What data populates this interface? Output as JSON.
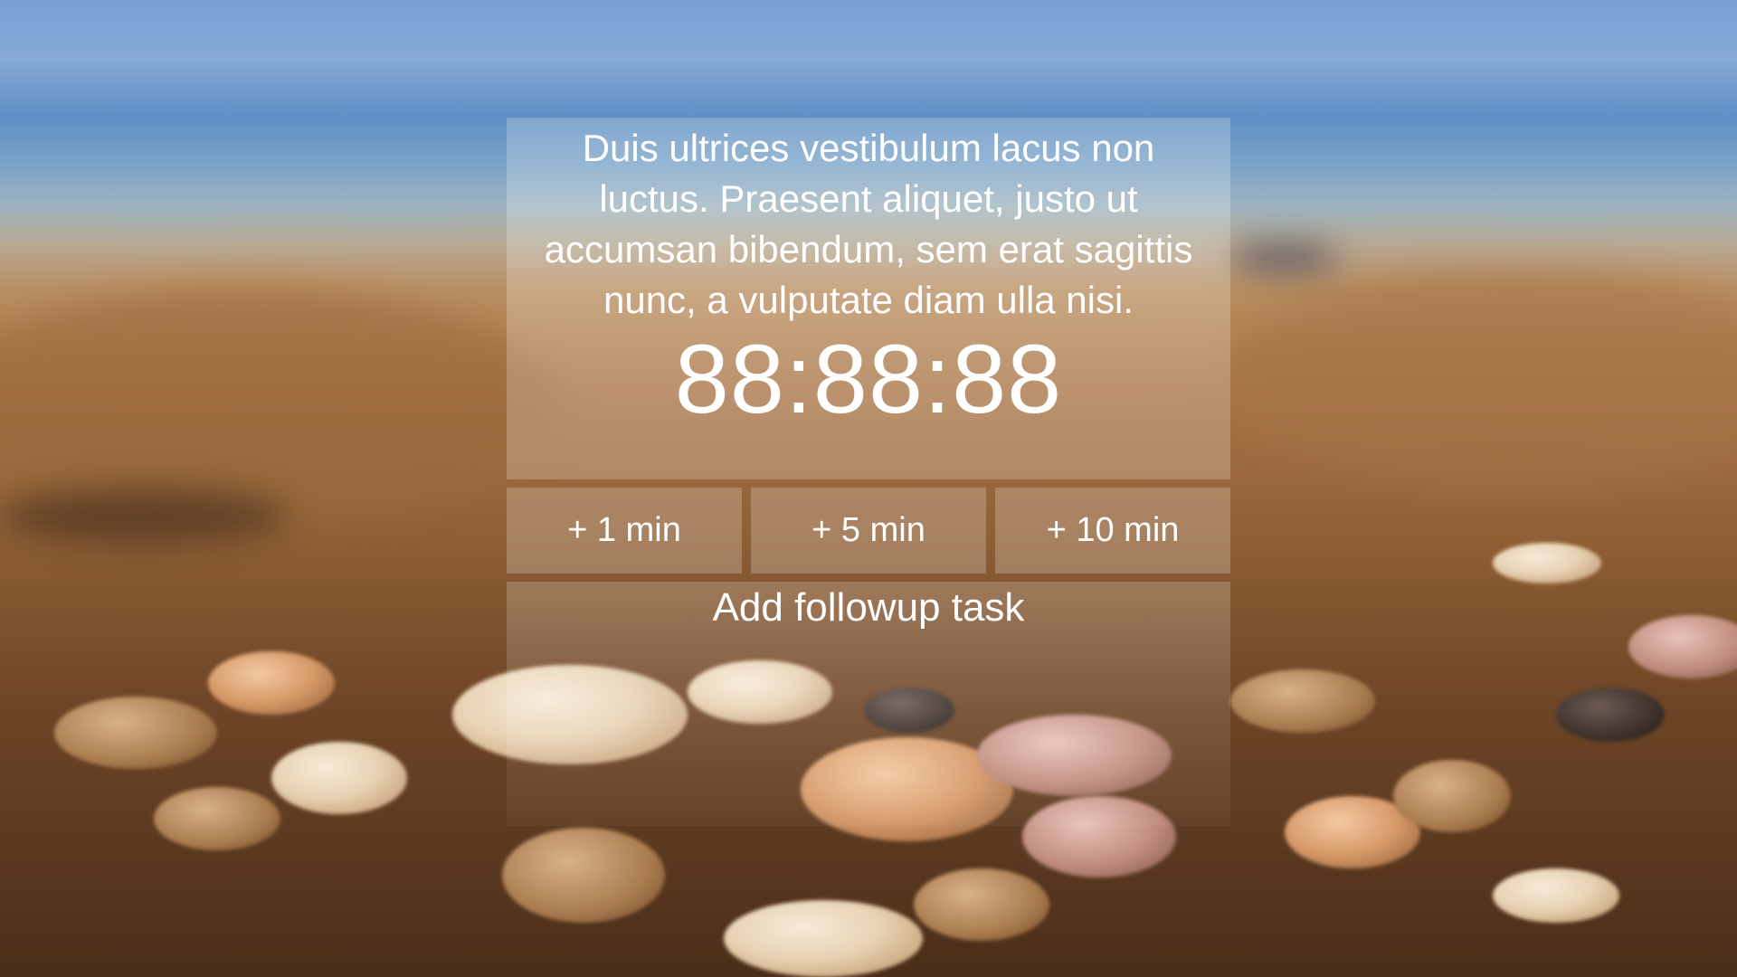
{
  "task": {
    "description": "Duis ultrices vestibulum lacus non luctus. Praesent aliquet, justo ut accumsan bibendum, sem erat sagittis nunc, a vulputate diam ulla nisi."
  },
  "timer": {
    "display": "88:88:88"
  },
  "add_time_buttons": [
    {
      "label": "+ 1 min"
    },
    {
      "label": "+ 5 min"
    },
    {
      "label": "+ 10 min"
    }
  ],
  "followup": {
    "label": "Add followup task"
  },
  "colors": {
    "text": "#ffffff",
    "panel_overlay": "rgba(255,255,255,0.22)"
  }
}
